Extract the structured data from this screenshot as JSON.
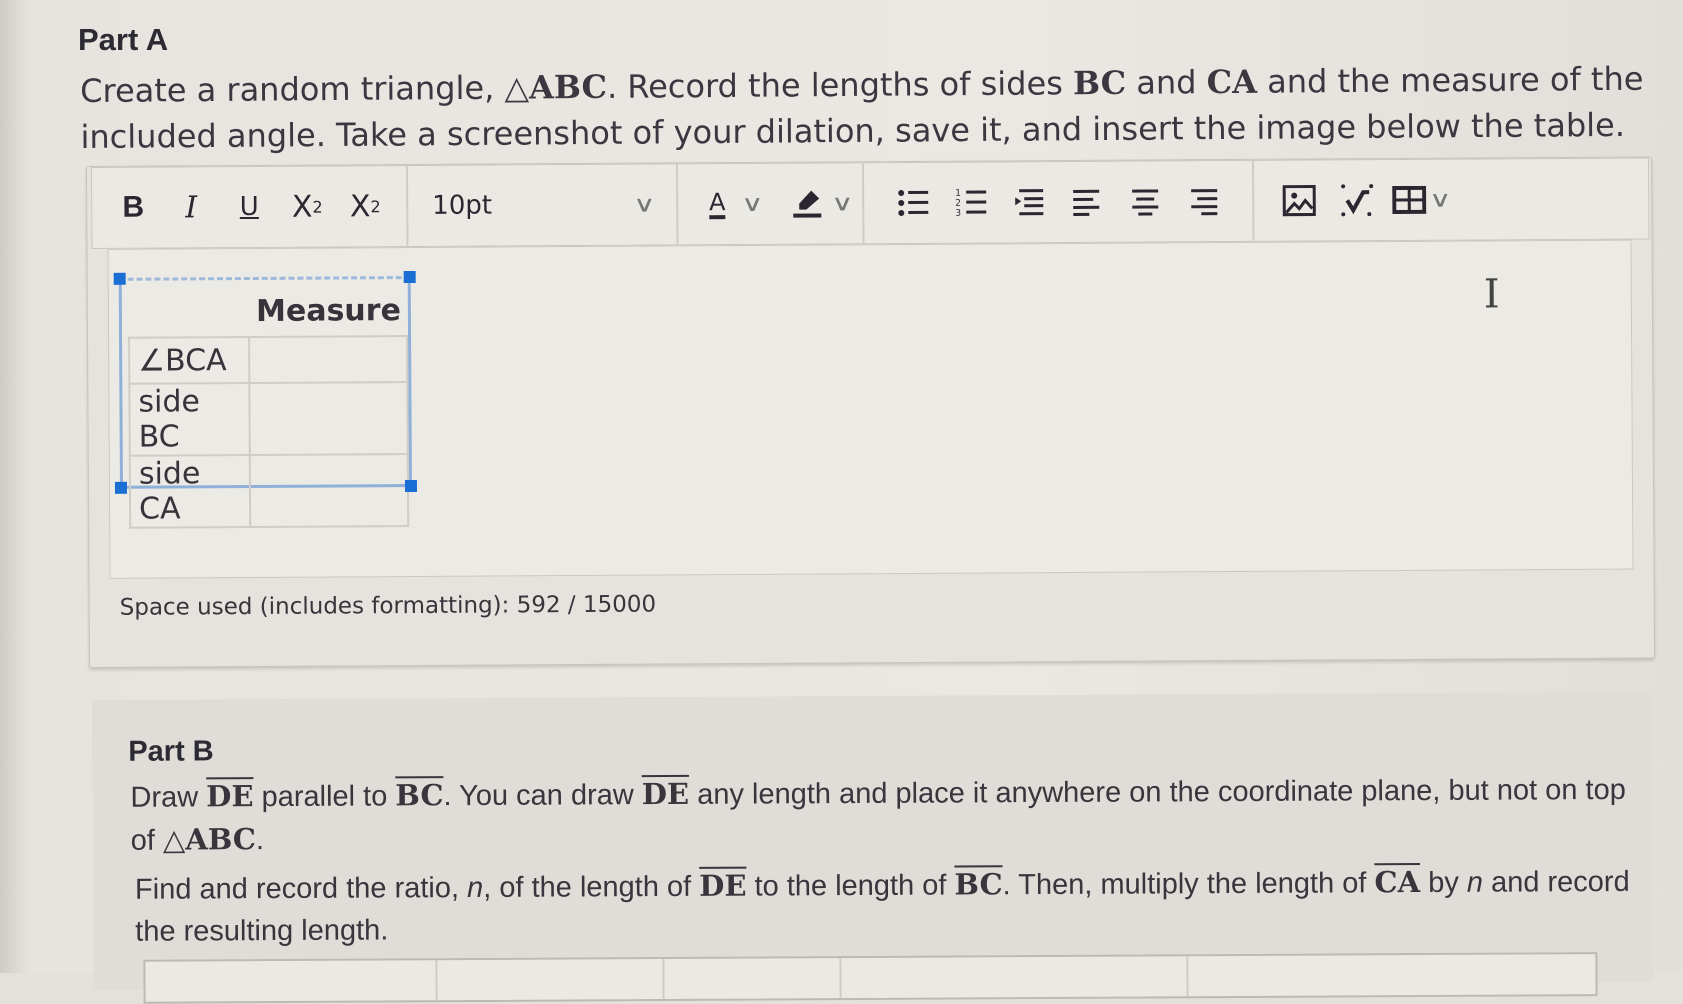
{
  "part_a": {
    "title": "Part A",
    "prompt_line1_a": "Create a random triangle, ",
    "prompt_triangle": "△ABC",
    "prompt_line1_b": ". Record the lengths of sides ",
    "side_bc": "BC",
    "and": " and ",
    "side_ca": "CA",
    "prompt_line1_c": " and the measure of the included angle. Take a screenshot of your dilation, save it, and insert the image below the table."
  },
  "toolbar": {
    "bold": "B",
    "italic": "I",
    "underline": "U",
    "superscript_base": "X",
    "superscript_exp": "2",
    "subscript_base": "X",
    "subscript_exp": "2",
    "font_size": "10pt",
    "font_color_letter": "A",
    "chevron": "∨"
  },
  "table": {
    "header": [
      "",
      "Measure"
    ],
    "rows": [
      {
        "label": "∠BCA",
        "value": ""
      },
      {
        "label": "side BC",
        "value": ""
      },
      {
        "label": "side CA",
        "value": ""
      }
    ]
  },
  "space_used": "Space used (includes formatting): 592 / 15000",
  "part_b": {
    "title": "Part B",
    "p1_a": "Draw ",
    "de": "DE",
    "p1_b": " parallel to ",
    "bc": "BC",
    "p1_c": ". You can draw ",
    "p1_d": " any length and place it anywhere on the coordinate plane, but not on top of ",
    "triangle": "△ABC",
    "p1_e": ".",
    "p2_a": "Find and record the ratio, ",
    "n": "n",
    "p2_b": ", of the length of ",
    "p2_c": " to the length of ",
    "p2_d": ". Then, multiply the length of ",
    "ca": "CA",
    "p2_e": " by ",
    "p2_f": " and record the resulting length."
  },
  "colors": {
    "selection_handle": "#1b6fd4",
    "selection_border": "#8fb0d8"
  }
}
